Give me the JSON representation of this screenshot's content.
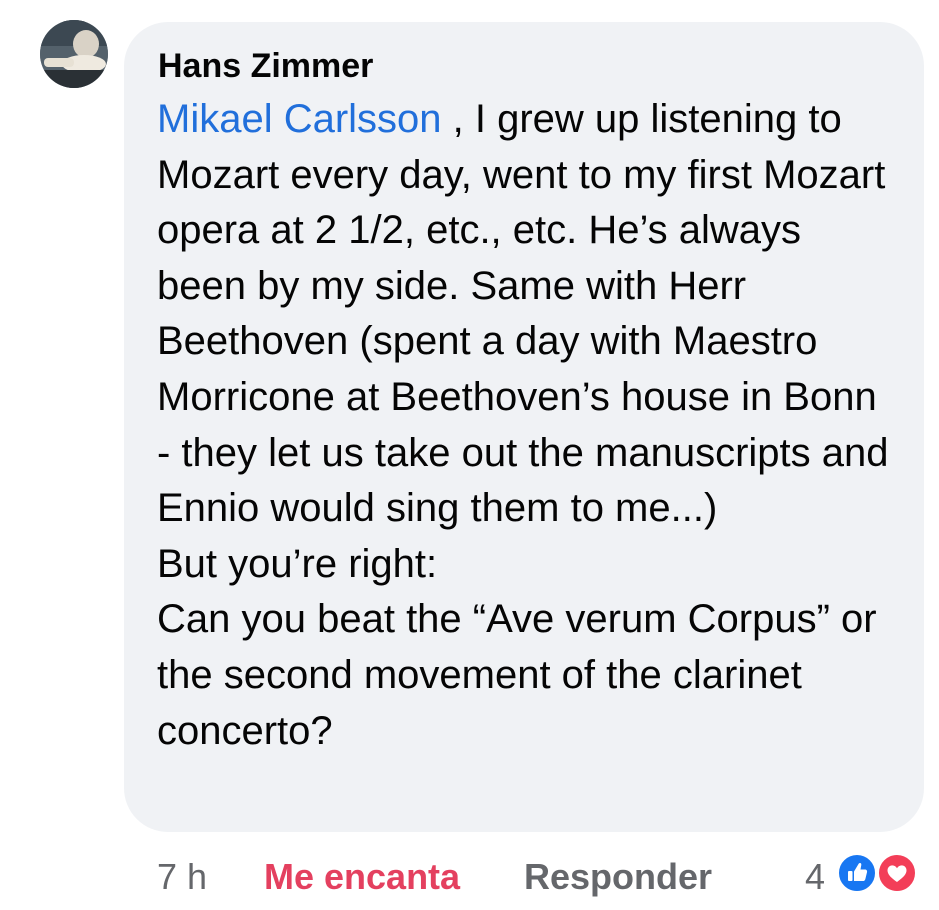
{
  "comment": {
    "author": "Hans Zimmer",
    "mention": "Mikael Carlsson",
    "text": " , I grew up listening to Mozart every day, went to my first Mozart opera at 2 1/2, etc., etc. He’s always been by my side. Same with Herr Beethoven (spent a day with Maestro Morricone at Beethoven’s house in Bonn - they let us take out the manuscripts and Ennio would sing them to me...)\nBut you’re right:\nCan you beat the “Ave verum Corpus” or the second movement of the clarinet concerto?"
  },
  "footer": {
    "time": "7 h",
    "reaction_label": "Me encanta",
    "reply_label": "Responder",
    "reaction_count": "4",
    "reaction_icons": [
      "like-icon",
      "love-icon"
    ]
  },
  "colors": {
    "bubble": "#f0f2f5",
    "mention": "#216fdb",
    "reaction_label": "#e4405f",
    "muted": "#65676b",
    "like": "#1877f2",
    "love": "#f33e58"
  }
}
